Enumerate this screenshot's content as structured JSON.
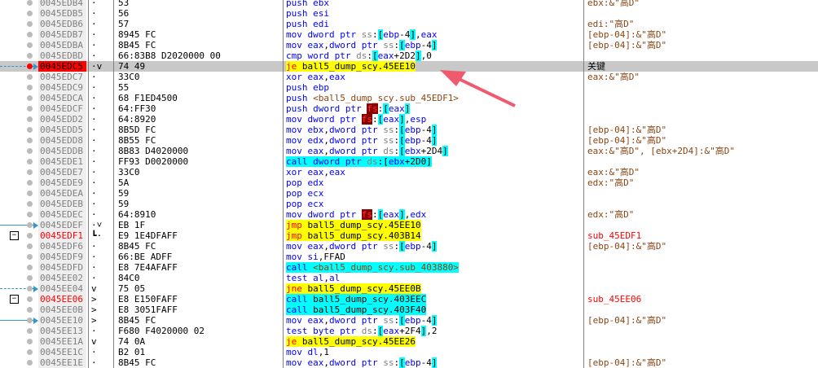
{
  "colors": {
    "selected_row": "#c8c8c8",
    "breakpoint": "#ff0000",
    "jump_highlight": "#ffff00",
    "call_highlight": "#00ffff",
    "annotation_arrow": "#f05a6e"
  },
  "annotation": {
    "label": "关键"
  },
  "rows": [
    {
      "addr": "0045EDB4",
      "jm": "·",
      "bytes": "53",
      "ins": "push ebx",
      "com": "ebx:&\"高D\""
    },
    {
      "addr": "0045EDB5",
      "jm": "·",
      "bytes": "56",
      "ins": "push esi",
      "com": ""
    },
    {
      "addr": "0045EDB6",
      "jm": "·",
      "bytes": "57",
      "ins": "push edi",
      "com": "edi:\"高D\""
    },
    {
      "addr": "0045EDB7",
      "jm": "·",
      "bytes": "8945 FC",
      "ins": "mov dword ptr ss:[ebp-4],eax",
      "com": "[ebp-04]:&\"高D\""
    },
    {
      "addr": "0045EDBA",
      "jm": "·",
      "bytes": "8B45 FC",
      "ins": "mov eax,dword ptr ss:[ebp-4]",
      "com": "[ebp-04]:&\"高D\""
    },
    {
      "addr": "0045EDBD",
      "jm": "·",
      "bytes": "66:83B8 D2020000 00",
      "ins": "cmp word ptr ds:[eax+2D2],0",
      "com": ""
    },
    {
      "addr": "0045EDC5",
      "jm": "·v",
      "bytes": "74 49",
      "ins": "je ball5_dump_scy.45EE10",
      "com": "关键"
    },
    {
      "addr": "0045EDC7",
      "jm": "·",
      "bytes": "33C0",
      "ins": "xor eax,eax",
      "com": "eax:&\"高D\""
    },
    {
      "addr": "0045EDC9",
      "jm": "·",
      "bytes": "55",
      "ins": "push ebp",
      "com": ""
    },
    {
      "addr": "0045EDCA",
      "jm": "·",
      "bytes": "68 F1ED4500",
      "ins": "push <ball5_dump_scy.sub_45EDF1>",
      "com": ""
    },
    {
      "addr": "0045EDCF",
      "jm": "·",
      "bytes": "64:FF30",
      "ins": "push dword ptr fs:[eax]",
      "com": ""
    },
    {
      "addr": "0045EDD2",
      "jm": "·",
      "bytes": "64:8920",
      "ins": "mov dword ptr fs:[eax],esp",
      "com": ""
    },
    {
      "addr": "0045EDD5",
      "jm": "·",
      "bytes": "8B5D FC",
      "ins": "mov ebx,dword ptr ss:[ebp-4]",
      "com": "[ebp-04]:&\"高D\""
    },
    {
      "addr": "0045EDD8",
      "jm": "·",
      "bytes": "8B55 FC",
      "ins": "mov edx,dword ptr ss:[ebp-4]",
      "com": "[ebp-04]:&\"高D\""
    },
    {
      "addr": "0045EDDB",
      "jm": "·",
      "bytes": "8B83 D4020000",
      "ins": "mov eax,dword ptr ds:[ebx+2D4]",
      "com": "eax:&\"高D\", [ebx+2D4]:&\"高D\""
    },
    {
      "addr": "0045EDE1",
      "jm": "·",
      "bytes": "FF93 D0020000",
      "ins": "call dword ptr ds:[ebx+2D0]",
      "com": ""
    },
    {
      "addr": "0045EDE7",
      "jm": "·",
      "bytes": "33C0",
      "ins": "xor eax,eax",
      "com": "eax:&\"高D\""
    },
    {
      "addr": "0045EDE9",
      "jm": "·",
      "bytes": "5A",
      "ins": "pop edx",
      "com": "edx:\"高D\""
    },
    {
      "addr": "0045EDEA",
      "jm": "·",
      "bytes": "59",
      "ins": "pop ecx",
      "com": ""
    },
    {
      "addr": "0045EDEB",
      "jm": "·",
      "bytes": "59",
      "ins": "pop ecx",
      "com": ""
    },
    {
      "addr": "0045EDEC",
      "jm": "·",
      "bytes": "64:8910",
      "ins": "mov dword ptr fs:[eax],edx",
      "com": "edx:\"高D\""
    },
    {
      "addr": "0045EDEF",
      "jm": "·˅",
      "bytes": "EB 1F",
      "ins": "jmp ball5_dump_scy.45EE10",
      "com": ""
    },
    {
      "addr": "0045EDF1",
      "jm": "┗·",
      "bytes": "E9 1E4DFAFF",
      "ins": "jmp ball5_dump_scy.403B14",
      "com": "sub_45EDF1"
    },
    {
      "addr": "0045EDF6",
      "jm": "·",
      "bytes": "8B45 FC",
      "ins": "mov eax,dword ptr ss:[ebp-4]",
      "com": "[ebp-04]:&\"高D\""
    },
    {
      "addr": "0045EDF9",
      "jm": "·",
      "bytes": "66:BE ADFF",
      "ins": "mov si,FFAD",
      "com": ""
    },
    {
      "addr": "0045EDFD",
      "jm": "·",
      "bytes": "E8 7E4AFAFF",
      "ins": "call <ball5_dump_scy.sub_403880>",
      "com": ""
    },
    {
      "addr": "0045EE02",
      "jm": "·",
      "bytes": "84C0",
      "ins": "test al,al",
      "com": ""
    },
    {
      "addr": "0045EE04",
      "jm": "v",
      "bytes": "75 05",
      "ins": "jne ball5_dump_scy.45EE0B",
      "com": ""
    },
    {
      "addr": "0045EE06",
      "jm": ">",
      "bytes": "E8 E150FAFF",
      "ins": "call ball5_dump_scy.403EEC",
      "com": "sub_45EE06"
    },
    {
      "addr": "0045EE0B",
      "jm": ">",
      "bytes": "E8 3051FAFF",
      "ins": "call ball5_dump_scy.403F40",
      "com": ""
    },
    {
      "addr": "0045EE10",
      "jm": ">",
      "bytes": "8B45 FC",
      "ins": "mov eax,dword ptr ss:[ebp-4]",
      "com": "[ebp-04]:&\"高D\""
    },
    {
      "addr": "0045EE13",
      "jm": "·",
      "bytes": "F680 F4020000 02",
      "ins": "test byte ptr ds:[eax+2F4],2",
      "com": ""
    },
    {
      "addr": "0045EE1A",
      "jm": "v",
      "bytes": "74 0A",
      "ins": "je ball5_dump_scy.45EE26",
      "com": ""
    },
    {
      "addr": "0045EE1C",
      "jm": "·",
      "bytes": "B2 01",
      "ins": "mov dl,1",
      "com": ""
    },
    {
      "addr": "0045EE1E",
      "jm": "·",
      "bytes": "8B45 FC",
      "ins": "mov eax,dword ptr ss:[ebp-4]",
      "com": "[ebp-04]:&\"高D\""
    }
  ]
}
